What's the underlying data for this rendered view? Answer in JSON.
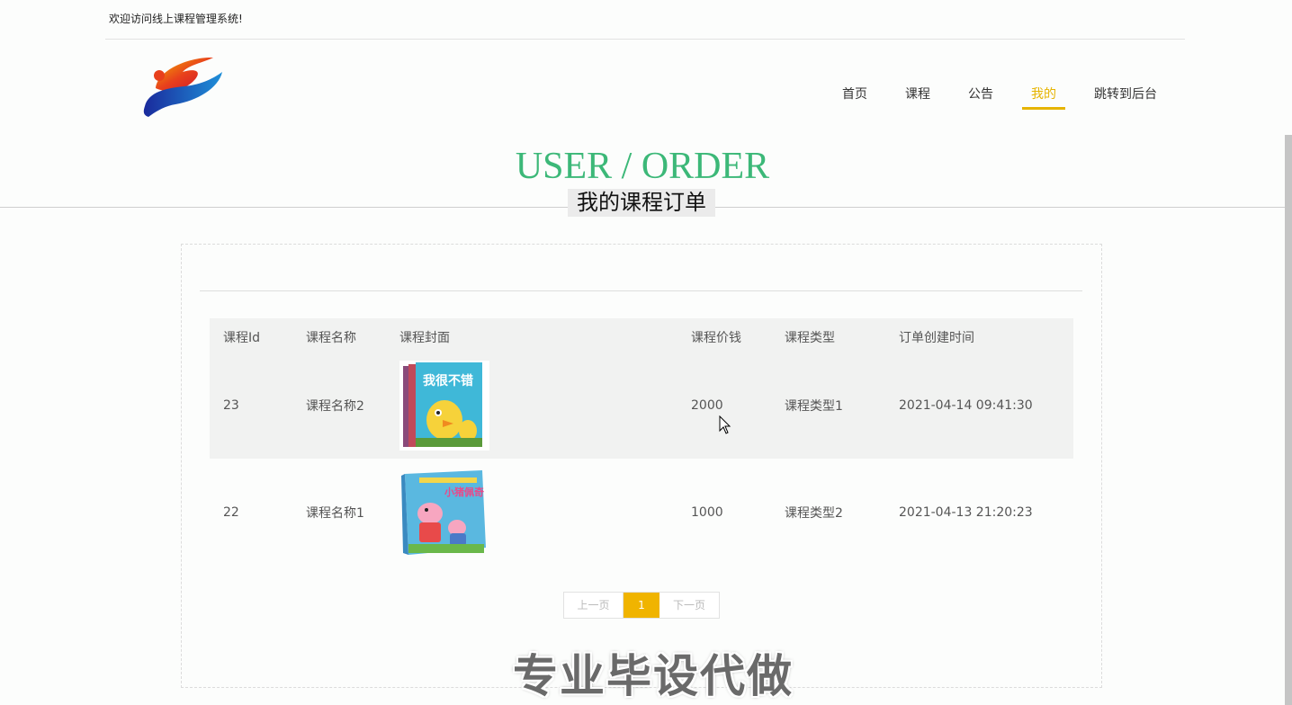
{
  "header": {
    "welcome": "欢迎访问线上课程管理系统!"
  },
  "nav": {
    "items": [
      {
        "label": "首页"
      },
      {
        "label": "课程"
      },
      {
        "label": "公告"
      },
      {
        "label": "我的"
      },
      {
        "label": "跳转到后台"
      }
    ],
    "active_index": 3,
    "accent_color": "#e6b400"
  },
  "section": {
    "title_en": "USER / ORDER",
    "title_cn": "我的课程订单",
    "title_color": "#3cb878"
  },
  "table": {
    "columns": [
      "课程Id",
      "课程名称",
      "课程封面",
      "课程价钱",
      "课程类型",
      "订单创建时间"
    ],
    "rows": [
      {
        "id": "23",
        "name": "课程名称2",
        "cover_icon": "book-cover-duck",
        "cover_text": "我很不错",
        "price": "2000",
        "type": "课程类型1",
        "created": "2021-04-14 09:41:30"
      },
      {
        "id": "22",
        "name": "课程名称1",
        "cover_icon": "book-cover-peppa",
        "cover_text": "小猪佩奇",
        "price": "1000",
        "type": "课程类型2",
        "created": "2021-04-13 21:20:23"
      }
    ]
  },
  "pagination": {
    "prev": "上一页",
    "current": "1",
    "next": "下一页",
    "accent_color": "#f0b400"
  },
  "watermark": "专业毕设代做"
}
